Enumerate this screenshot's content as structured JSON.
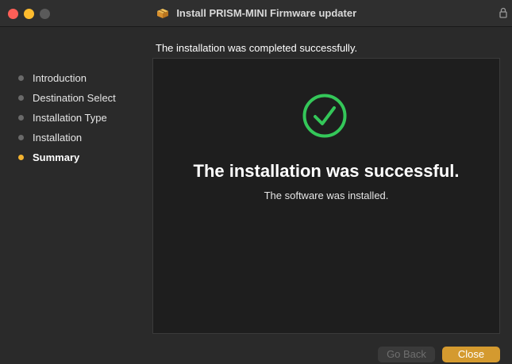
{
  "window": {
    "title": "Install PRISM-MINI Firmware updater"
  },
  "header": {
    "status_text": "The installation was completed successfully."
  },
  "sidebar": {
    "steps": [
      {
        "label": "Introduction",
        "state": "done"
      },
      {
        "label": "Destination Select",
        "state": "done"
      },
      {
        "label": "Installation Type",
        "state": "done"
      },
      {
        "label": "Installation",
        "state": "done"
      },
      {
        "label": "Summary",
        "state": "active"
      }
    ]
  },
  "main": {
    "icon": "checkmark-circle-icon",
    "title": "The installation was successful.",
    "subtitle": "The software was installed."
  },
  "buttons": {
    "back_label": "Go Back",
    "back_enabled": false,
    "close_label": "Close"
  },
  "colors": {
    "accent": "#d49a2f",
    "success": "#34c759",
    "active_dot": "#f2b230"
  }
}
